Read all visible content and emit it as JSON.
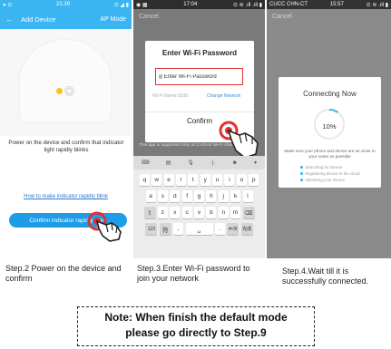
{
  "panel1": {
    "status_left": "● ⊙",
    "status_time": "21:39",
    "status_right": "⊙ ◢ ▮",
    "back_glyph": "←",
    "title": "Add Device",
    "mode": "AP Mode",
    "message": "Power on the device and confirm that indicator light rapidly blinks",
    "help_link": "How to make indicator rapidly blink",
    "confirm_button": "Confirm indicator rapidly blink",
    "accent": "#3bb4f2",
    "button_color": "#1e9de6"
  },
  "panel2": {
    "status_left": "◉ ▦",
    "status_time": "17:04",
    "status_right": "⊙ ≋ .ıll .ıll ▮",
    "cancel": "Cancel",
    "dialog_title": "Enter Wi-Fi Password",
    "password_value": "Enter Wi-Fi Password",
    "network_name": "Wi-Fi Name:SSID",
    "change_network": "Change Network",
    "confirm": "Confirm",
    "support_note": "This app is supported only on 2.4GHz Wi-Fi channels",
    "keyboard": {
      "toolbar": [
        "⌨",
        "▤",
        "🎙",
        "·|·",
        "☻",
        "▾"
      ],
      "row1": [
        "q",
        "w",
        "e",
        "r",
        "t",
        "y",
        "u",
        "i",
        "o",
        "p"
      ],
      "row2": [
        "a",
        "s",
        "d",
        "f",
        "g",
        "h",
        "j",
        "k",
        "l"
      ],
      "row3": [
        "⇧",
        "z",
        "x",
        "c",
        "v",
        "b",
        "n",
        "m",
        "⌫"
      ],
      "row4": [
        "123",
        "符",
        ",",
        "␣",
        ".",
        "中/英",
        "完成"
      ]
    }
  },
  "panel3": {
    "status_left": "CUCC CHN-CT",
    "status_time": "15:57",
    "status_right": "⊙ ≋ .ıll ▮",
    "cancel": "Cancel",
    "dialog_title": "Connecting Now",
    "percent": "10%",
    "progress": 0.1,
    "hint": "Make sure your phone and device are as close to your router as possible",
    "steps": [
      "Searching for Device",
      "Registering device to the cloud",
      "Initializing your Device"
    ],
    "accent": "#3bb4f2"
  },
  "captions": {
    "step2": "Step.2 Power on the device and confirm",
    "step3": "Step.3.Enter Wi-Fi password to join your network",
    "step4": "Step.4.Wait till it is successfully connected."
  },
  "note": {
    "line1": "Note: When finish the default mode",
    "line2": "please go directly to Step.9"
  }
}
